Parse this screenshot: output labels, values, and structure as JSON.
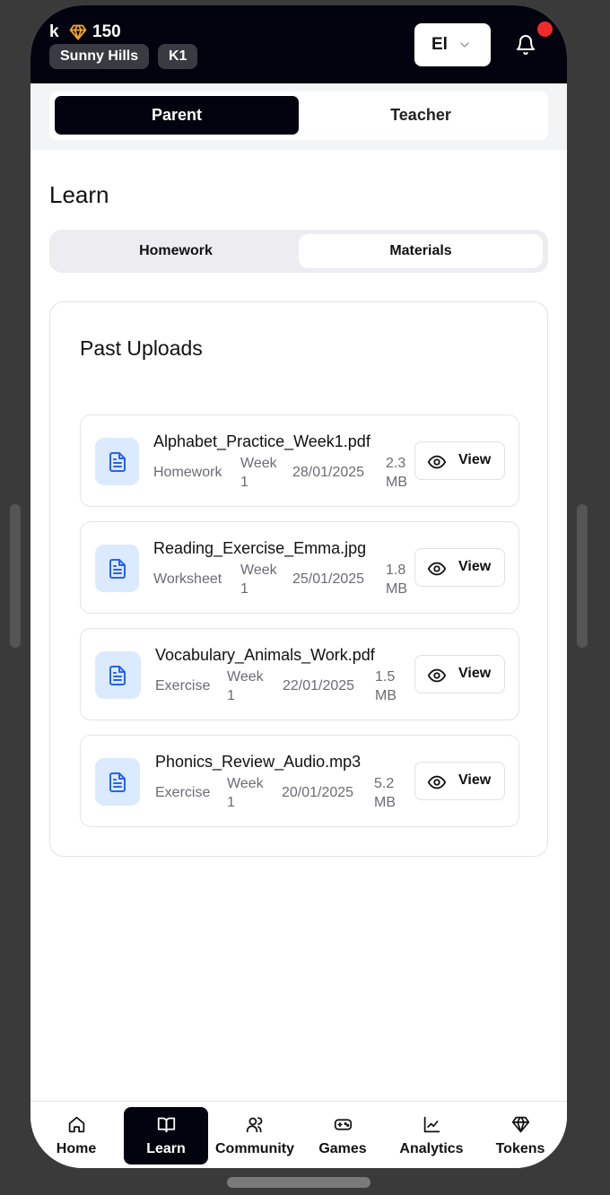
{
  "header": {
    "user_initial": "k",
    "token_count": "150",
    "school": "Sunny Hills",
    "grade": "K1",
    "language": "El",
    "has_notification": true,
    "accent_color": "#f5a623",
    "notification_color": "#ef2b2b"
  },
  "role_switch": {
    "options": [
      {
        "label": "Parent",
        "selected": true
      },
      {
        "label": "Teacher",
        "selected": false
      }
    ]
  },
  "page_title": "Learn",
  "tabs": [
    {
      "label": "Homework",
      "selected": false
    },
    {
      "label": "Materials",
      "selected": true
    }
  ],
  "uploads_card": {
    "title": "Past Uploads",
    "items": [
      {
        "name": "Alphabet_Practice_Week1.pdf",
        "type": "Homework",
        "week": "Week",
        "week_num": "1",
        "date": "28/01/2025",
        "size": "2.3",
        "size_unit": "MB",
        "icon": "file-text-icon",
        "action": "View"
      },
      {
        "name": "Reading_Exercise_Emma.jpg",
        "type": "Worksheet",
        "week": "Week",
        "week_num": "1",
        "date": "25/01/2025",
        "size": "1.8",
        "size_unit": "MB",
        "icon": "file-text-icon",
        "action": "View"
      },
      {
        "name": "Vocabulary_Animals_Work.pdf",
        "type": "Exercise",
        "week": "Week",
        "week_num": "1",
        "date": "22/01/2025",
        "size": "1.5",
        "size_unit": "MB",
        "icon": "file-text-icon",
        "action": "View"
      },
      {
        "name": "Phonics_Review_Audio.mp3",
        "type": "Exercise",
        "week": "Week",
        "week_num": "1",
        "date": "20/01/2025",
        "size": "5.2",
        "size_unit": "MB",
        "icon": "file-text-icon",
        "action": "View"
      }
    ]
  },
  "bottom_nav": [
    {
      "label": "Home",
      "icon": "home-icon",
      "active": false
    },
    {
      "label": "Learn",
      "icon": "book-open-icon",
      "active": true
    },
    {
      "label": "Community",
      "icon": "users-icon",
      "active": false
    },
    {
      "label": "Games",
      "icon": "gamepad-icon",
      "active": false
    },
    {
      "label": "Analytics",
      "icon": "chart-line-icon",
      "active": false
    },
    {
      "label": "Tokens",
      "icon": "gem-icon",
      "active": false
    }
  ]
}
